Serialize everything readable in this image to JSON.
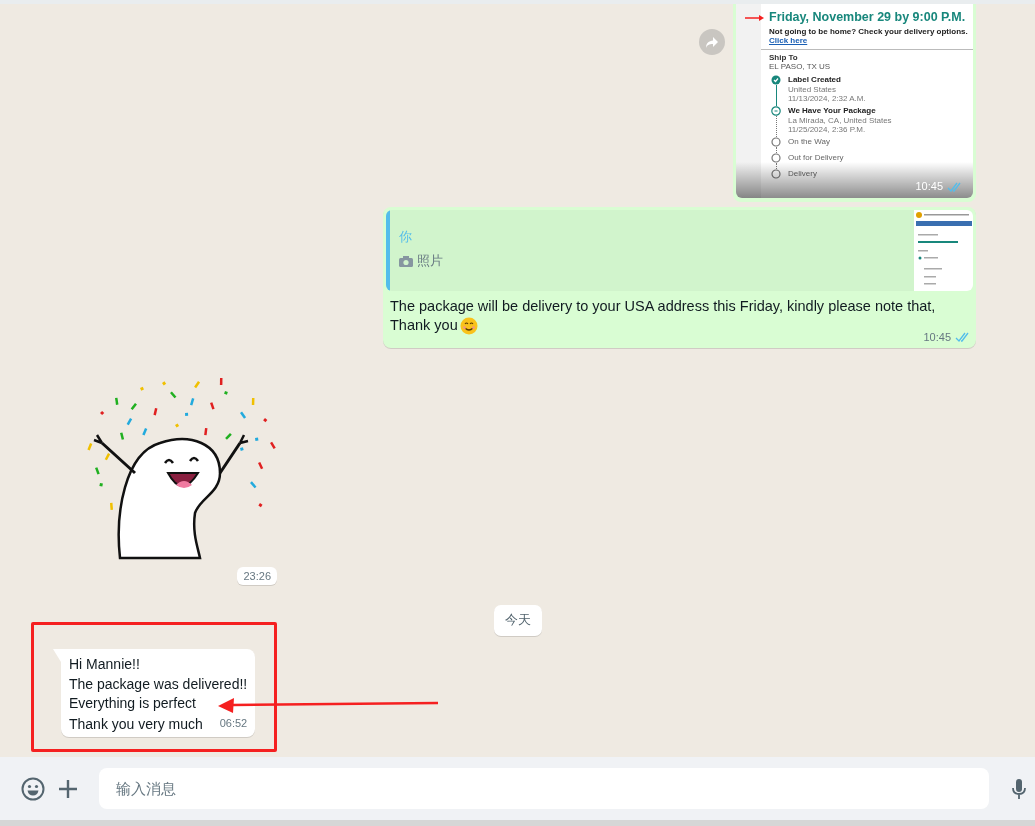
{
  "chat": {
    "messages": [
      {
        "kind": "image",
        "outgoing": true,
        "time": "10:45",
        "read": true,
        "tracking": {
          "heading": "Friday, November 29 by 9:00 P.M.",
          "note": "Not going to be home? Check your delivery options.",
          "link": "Click here",
          "ship_to_label": "Ship To",
          "ship_to": "EL PASO, TX US",
          "steps": [
            {
              "kind": "done",
              "title": "Label Created",
              "details": [
                "United States",
                "11/13/2024, 2:32 A.M."
              ]
            },
            {
              "kind": "current",
              "title": "We Have Your Package",
              "details": [
                "La Mirada, CA, United States",
                "11/25/2024, 2:36 P.M."
              ]
            },
            {
              "kind": "pending",
              "title": "On the Way"
            },
            {
              "kind": "pending",
              "title": "Out for Delivery"
            },
            {
              "kind": "pending",
              "title": "Delivery"
            }
          ]
        }
      },
      {
        "kind": "reply",
        "outgoing": true,
        "quote": {
          "author": "你",
          "media_label": "照片"
        },
        "lines": [
          "The package will be delivery to your USA address this Friday, kindly please note that,",
          "Thank you"
        ],
        "time": "10:45",
        "read": true
      },
      {
        "kind": "sticker",
        "time": "23:26"
      },
      {
        "kind": "date",
        "text": "今天"
      },
      {
        "kind": "text",
        "outgoing": false,
        "lines": [
          "Hi Mannie!!",
          "The package was delivered!!",
          "Everything is perfect",
          "Thank you very much"
        ],
        "time": "06:52",
        "highlighted": true
      }
    ]
  },
  "composer": {
    "placeholder": "输入消息"
  }
}
